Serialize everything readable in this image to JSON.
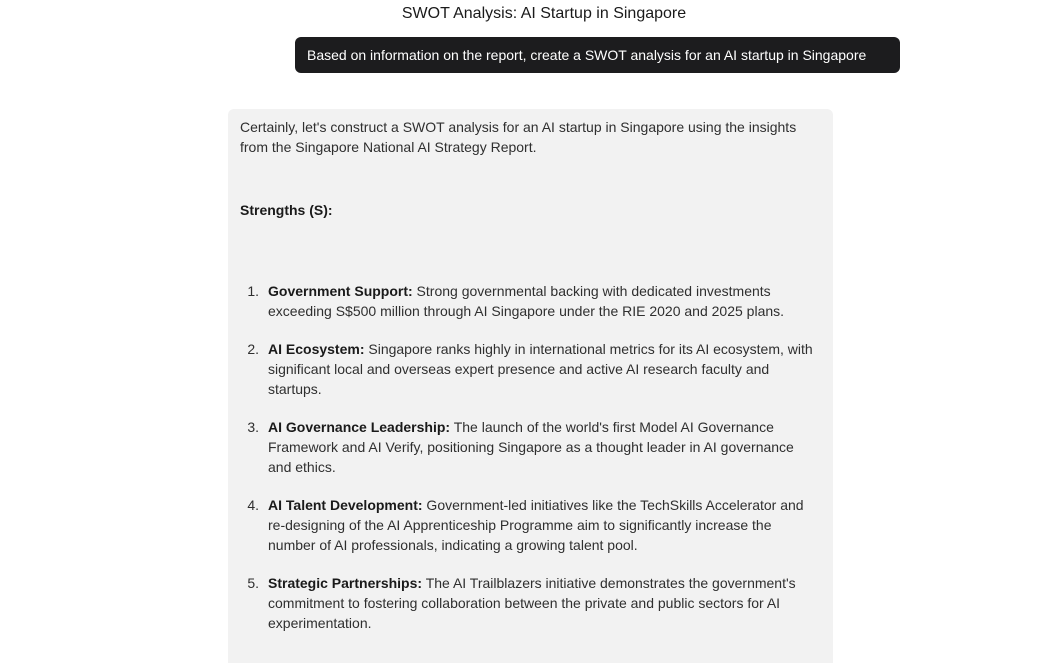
{
  "title": "SWOT Analysis: AI Startup in Singapore",
  "user_message": "Based on information on the report, create a SWOT analysis for an AI startup in Singapore",
  "assistant": {
    "intro": "Certainly, let's construct a SWOT analysis for an AI startup in Singapore using the insights from the Singapore National AI Strategy Report.",
    "section_heading": "Strengths (S):",
    "strengths": [
      {
        "num": "1.",
        "title": "Government Support:",
        "text": " Strong governmental backing with dedicated investments exceeding S$500 million through AI Singapore under the RIE 2020 and 2025 plans."
      },
      {
        "num": "2.",
        "title": "AI Ecosystem:",
        "text": " Singapore ranks highly in international metrics for its AI ecosystem, with significant local and overseas expert presence and active AI research faculty and startups."
      },
      {
        "num": "3.",
        "title": "AI Governance Leadership:",
        "text": " The launch of the world's first Model AI Governance Framework and AI Verify, positioning Singapore as a thought leader in AI governance and ethics."
      },
      {
        "num": "4.",
        "title": "AI Talent Development:",
        "text": " Government-led initiatives like the TechSkills Accelerator and re-designing of the AI Apprenticeship Programme aim to significantly increase the number of AI professionals, indicating a growing talent pool."
      },
      {
        "num": "5.",
        "title": "Strategic Partnerships:",
        "text": " The AI Trailblazers initiative demonstrates the government's commitment to fostering collaboration between the private and public sectors for AI experimentation."
      }
    ]
  }
}
